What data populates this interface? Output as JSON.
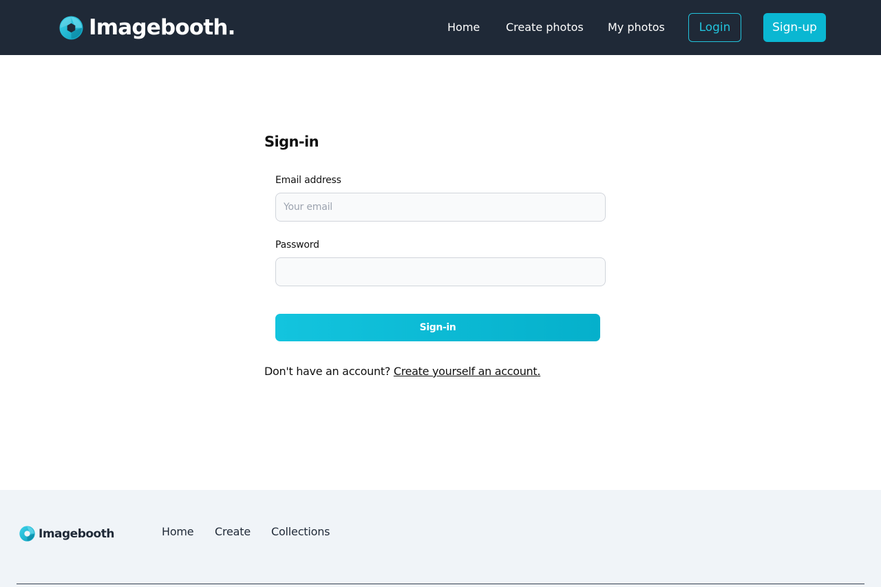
{
  "header": {
    "brand": "Imagebooth.",
    "nav": [
      {
        "label": "Home"
      },
      {
        "label": "Create photos"
      },
      {
        "label": "My photos"
      }
    ],
    "login_label": "Login",
    "signup_label": "Sign-up"
  },
  "form": {
    "title": "Sign-in",
    "email_label": "Email address",
    "email_placeholder": "Your email",
    "email_value": "",
    "password_label": "Password",
    "password_value": "",
    "submit_label": "Sign-in",
    "no_account_text": "Don't have an account?",
    "create_account_link": "Create yourself an account."
  },
  "footer": {
    "brand": "Imagebooth",
    "links": [
      {
        "label": "Home"
      },
      {
        "label": "Create"
      },
      {
        "label": "Collections"
      }
    ]
  },
  "icons": {
    "brand_logo": "camera-aperture-icon"
  },
  "colors": {
    "header_bg": "#1f2937",
    "accent": "#0ab7d2",
    "footer_bg": "#f0f4f8"
  }
}
